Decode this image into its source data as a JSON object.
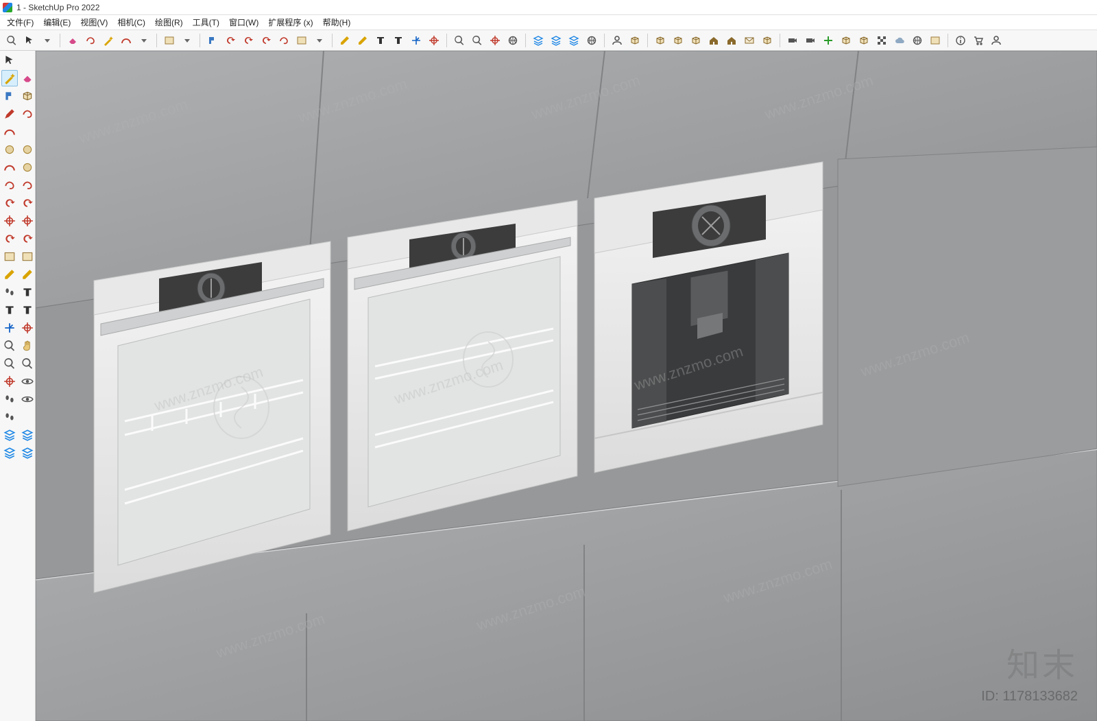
{
  "titlebar": {
    "app_icon": "sketchup-icon",
    "title": "1 - SketchUp Pro 2022"
  },
  "menu": {
    "items": [
      {
        "label": "文件(F)"
      },
      {
        "label": "编辑(E)"
      },
      {
        "label": "视图(V)"
      },
      {
        "label": "相机(C)"
      },
      {
        "label": "绘图(R)"
      },
      {
        "label": "工具(T)"
      },
      {
        "label": "窗口(W)"
      },
      {
        "label": "扩展程序 (x)"
      },
      {
        "label": "帮助(H)"
      }
    ]
  },
  "top_toolbar_icons": [
    "search-icon",
    "select-icon",
    "dropdown-icon",
    "eraser-icon",
    "lasso-icon",
    "wand-icon",
    "arc-icon",
    "dropdown-icon",
    "rect-icon",
    "dropdown-icon",
    "paint-icon",
    "rotate-arrow-icon",
    "sync-icon",
    "circle-arrows-icon",
    "rotate-curve-icon",
    "sheet-icon",
    "dropdown-icon",
    "ruler-icon",
    "ruler-square-icon",
    "text-label-icon",
    "text-box-icon",
    "axes-icon",
    "cut-plane-icon",
    "zoom-pencil-icon",
    "zoom-icon",
    "target-icon",
    "gear-icon",
    "layers-a-icon",
    "layers-b-icon",
    "layers-c-icon",
    "globe-icon",
    "person-outline-icon",
    "box-a-icon",
    "box-b-icon",
    "book-icon",
    "briefcase-icon",
    "home-icon",
    "home-outline-icon",
    "envelope-icon",
    "gift-icon",
    "camera-icon",
    "video-icon",
    "add-icon",
    "file-icon",
    "cube-icon",
    "checkers-icon",
    "cloud-icon",
    "sun-icon",
    "window-icon",
    "info-icon",
    "cart-icon",
    "avatar-icon"
  ],
  "left_toolbar_icons": [
    "select-arrow-icon",
    "blank-icon",
    "wand-tool-icon",
    "eraser-icon",
    "stamp-icon",
    "cube-tool-icon",
    "pencil-line-icon",
    "curve-icon",
    "arc-red-icon",
    "blank-icon",
    "circle-tan-icon",
    "poly-tan-icon",
    "half-circle-icon",
    "pentagon-icon",
    "s-curve-icon",
    "s-curve-b-icon",
    "rotate-a-icon",
    "rotate-b-icon",
    "crosshairs-icon",
    "target-red-icon",
    "refresh-a-icon",
    "refresh-b-icon",
    "sheet-icon",
    "paste-icon",
    "ruler-a-icon",
    "ruler-b-icon",
    "pin-a-icon",
    "text-label-icon",
    "a-box-icon",
    "a-box-outline-icon",
    "axes-tool-icon",
    "cut-plane-tool-icon",
    "zoom-wand-icon",
    "hand-pan-icon",
    "magnify-icon",
    "magnify-b-icon",
    "crosshair-tool-icon",
    "eye-icon",
    "measure-icon",
    "eye-b-icon",
    "footprints-icon",
    "blank-icon",
    "layers-a-icon",
    "layers-b-icon",
    "layers-c-icon",
    "layers-d-icon"
  ],
  "watermark": {
    "brand": "知末",
    "id_line": "ID: 1178133682",
    "url": "www.znzmo.com"
  },
  "viewport": {
    "model_description": "Built-in kitchen wall with three appliances: oven, oven, coffee machine",
    "colors": {
      "cabinet": "#9fa1a3",
      "appliance_body": "#ededed",
      "control_panel": "#3c3c3c"
    }
  }
}
